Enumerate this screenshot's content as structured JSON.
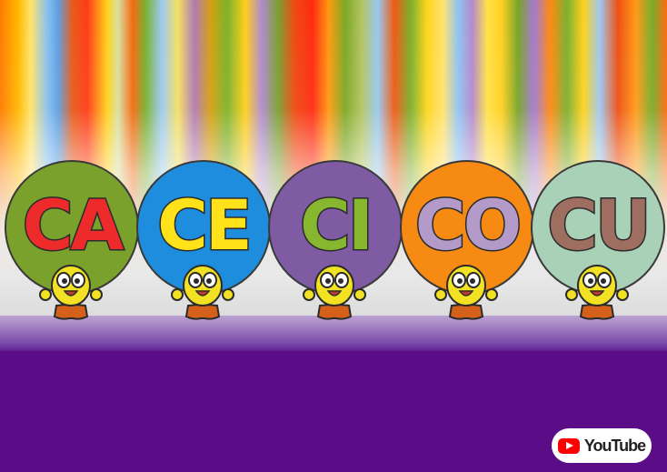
{
  "colors": {
    "floor": "#5a0d87",
    "stage_strip": "#a887c6",
    "outline": "#2b2b2b",
    "youtube_red": "#ff0000"
  },
  "syllables": [
    {
      "text": "CA",
      "ball_color": "#7aa12b",
      "letter_color": "#ee2b2b"
    },
    {
      "text": "CE",
      "ball_color": "#1f8ddd",
      "letter_color": "#ffe21a"
    },
    {
      "text": "CI",
      "ball_color": "#7e5ba3",
      "letter_color": "#86b72f"
    },
    {
      "text": "CO",
      "ball_color": "#f68a12",
      "letter_color": "#b39ac8"
    },
    {
      "text": "CU",
      "ball_color": "#a9d1b8",
      "letter_color": "#9e6e61"
    }
  ],
  "character": {
    "icon": "smiling-yellow-character-icon",
    "body_color": "#f2e223",
    "legs_color": "#d4601a"
  },
  "watermark": {
    "icon": "youtube-play-icon",
    "text": "YouTube"
  }
}
